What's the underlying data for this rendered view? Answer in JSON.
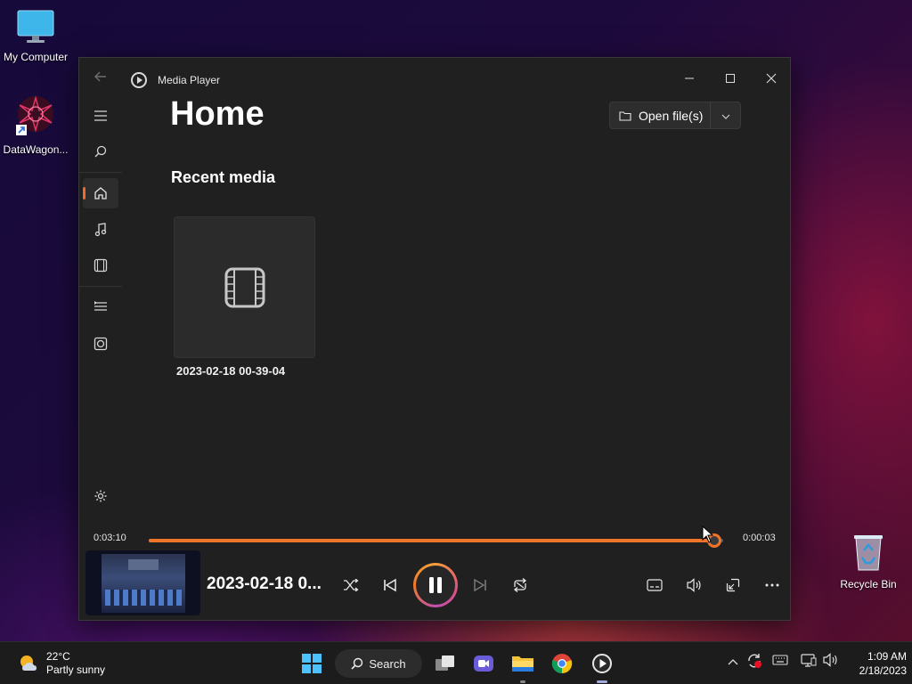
{
  "desktop": {
    "icons": [
      {
        "label": "My Computer"
      },
      {
        "label": "DataWagon..."
      },
      {
        "label": "Recycle Bin"
      }
    ]
  },
  "window": {
    "app_title": "Media Player",
    "heading": "Home",
    "open_files_label": "Open file(s)",
    "section_title": "Recent media",
    "recent": [
      {
        "name": "2023-02-18 00-39-04"
      }
    ]
  },
  "player": {
    "elapsed": "0:03:10",
    "remaining": "0:00:03",
    "progress": 0.985,
    "now_playing": "2023-02-18 0...",
    "accent_color": "#f0742a"
  },
  "taskbar": {
    "weather_temp": "22°C",
    "weather_desc": "Partly sunny",
    "search_label": "Search",
    "time": "1:09 AM",
    "date": "2/18/2023"
  }
}
